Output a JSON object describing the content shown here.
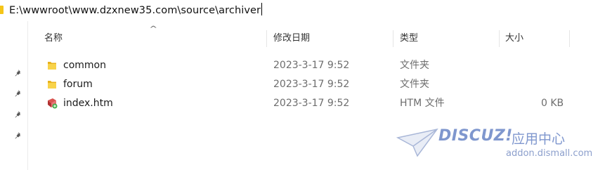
{
  "address_bar": {
    "path": "E:\\wwwroot\\www.dzxnew35.com\\source\\archiver"
  },
  "columns": {
    "name": "名称",
    "modified": "修改日期",
    "type": "类型",
    "size": "大小"
  },
  "sort_indicator": "^",
  "files": [
    {
      "name": "common",
      "modified": "2023-3-17 9:52",
      "type": "文件夹",
      "size": "",
      "icon": "folder-icon"
    },
    {
      "name": "forum",
      "modified": "2023-3-17 9:52",
      "type": "文件夹",
      "size": "",
      "icon": "folder-icon"
    },
    {
      "name": "index.htm",
      "modified": "2023-3-17 9:52",
      "type": "HTM 文件",
      "size": "0 KB",
      "icon": "htm-file-icon"
    }
  ],
  "watermark": {
    "brand": "DISCUZ!",
    "label": "应用中心",
    "url": "addon.dismall.com"
  },
  "colors": {
    "folder": "#f5c518",
    "watermark": "#7f97ce"
  }
}
